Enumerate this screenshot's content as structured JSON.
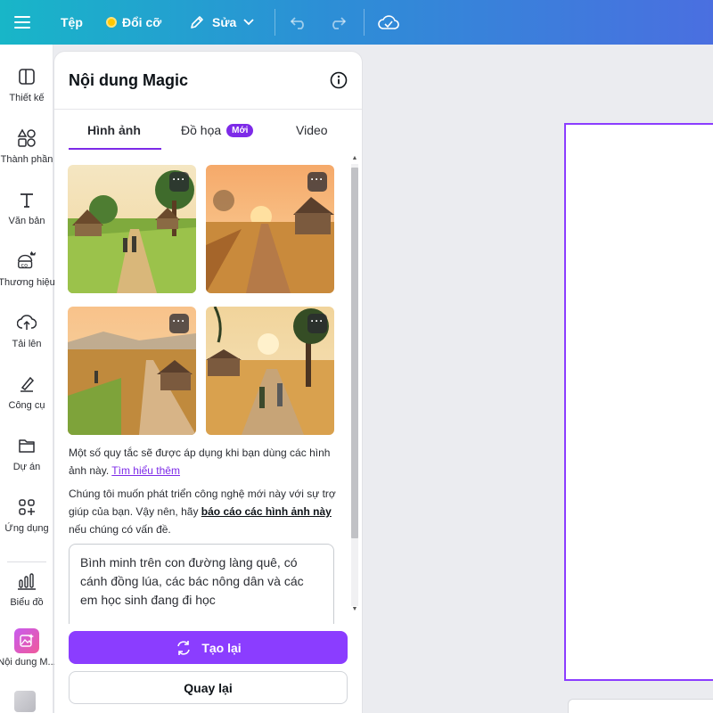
{
  "topbar": {
    "file_label": "Tệp",
    "resize_label": "Đổi cỡ",
    "edit_label": "Sửa",
    "icons": [
      "menu-icon",
      "crown-icon",
      "pencil-icon",
      "chevron-down-icon",
      "undo-icon",
      "redo-icon",
      "cloud-check-icon"
    ]
  },
  "rail": {
    "items": [
      {
        "label": "Thiết kế",
        "icon": "layout-icon"
      },
      {
        "label": "Thành phần",
        "icon": "elements-icon"
      },
      {
        "label": "Văn bản",
        "icon": "text-icon"
      },
      {
        "label": "Thương hiệu",
        "icon": "brand-icon"
      },
      {
        "label": "Tải lên",
        "icon": "upload-icon"
      },
      {
        "label": "Công cụ",
        "icon": "tools-icon"
      },
      {
        "label": "Dự án",
        "icon": "folder-icon"
      },
      {
        "label": "Ứng dụng",
        "icon": "apps-icon"
      },
      {
        "label": "Biểu đồ",
        "icon": "chart-icon"
      },
      {
        "label": "Nội dung M...",
        "icon": "magic-media-icon"
      }
    ]
  },
  "panel": {
    "title": "Nội dung Magic",
    "tabs": [
      {
        "label": "Hình ảnh",
        "active": true
      },
      {
        "label": "Đồ họa",
        "badge": "Mới"
      },
      {
        "label": "Video"
      }
    ],
    "more_label": "···",
    "note1_text": "Một số quy tắc sẽ được áp dụng khi bạn dùng các hình ảnh này.",
    "note1_link": "Tìm hiểu thêm",
    "note2_prefix": "Chúng tôi muốn phát triển công nghệ mới này với sự trợ giúp của bạn. Vậy nên, hãy",
    "note2_link": "báo cáo các hình ảnh này",
    "note2_suffix": "nếu chúng có vấn đề.",
    "prompt": "Bình minh trên con đường làng quê, có cánh đồng lúa, các bác nông dân và các em học sinh đang đi học",
    "regenerate_label": "Tạo lại",
    "back_label": "Quay lại"
  },
  "colors": {
    "accent": "#8b3dff",
    "topbar_start": "#18b6c8",
    "topbar_end": "#4a6fe0"
  }
}
